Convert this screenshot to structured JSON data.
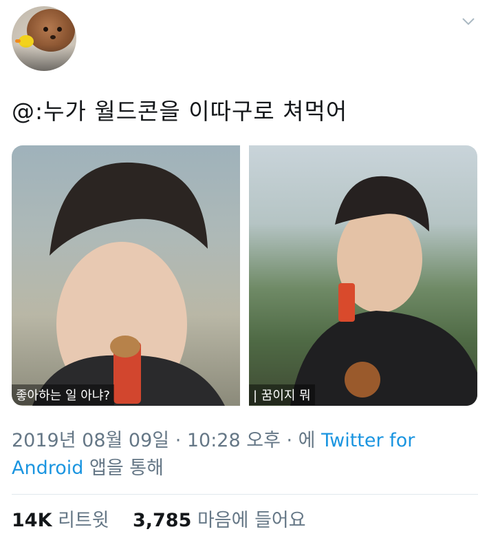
{
  "tweet": {
    "text": "@:누가 월드콘을 이따구로 쳐먹어",
    "media": [
      {
        "subtitle": "좋아하는 일 아냐?"
      },
      {
        "subtitle": "| 꿈이지 뭐"
      }
    ],
    "timestamp": "2019년 08월 09일 · 10:28 오후 · 에 ",
    "source_link": "Twitter for Android",
    "source_suffix": " 앱을 통해"
  },
  "stats": {
    "retweets_count": "14K",
    "retweets_label": "리트윗",
    "likes_count": "3,785",
    "likes_label": "마음에 들어요"
  },
  "icons": {
    "menu": "chevron-down-icon",
    "avatar": "profile-avatar"
  },
  "colors": {
    "link": "#1b95e0",
    "muted": "#657786",
    "text": "#14171a"
  }
}
